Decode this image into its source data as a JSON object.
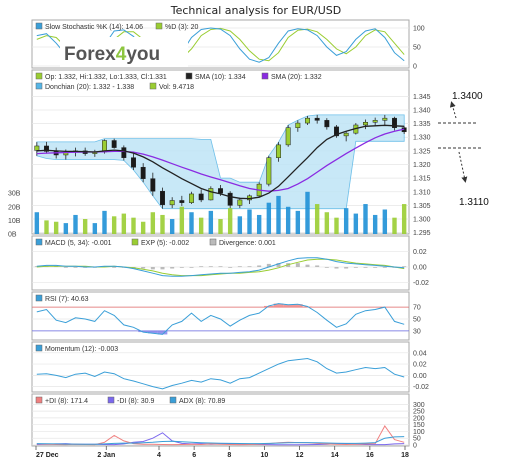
{
  "chart_data": {
    "type": "line",
    "title": "Technical analysis for EUR/USD",
    "x_ticks": [
      "27 Dec",
      "2 Jan",
      "4",
      "6",
      "8",
      "10",
      "12",
      "14",
      "16",
      "18"
    ],
    "stochastic": {
      "legend": [
        "Slow Stochastic %K (14): 14.06",
        "%D (3): 20"
      ],
      "ticks": [
        "100",
        "50",
        "0"
      ],
      "range": [
        0,
        100
      ],
      "k": [
        80,
        85,
        60,
        30,
        10,
        12,
        18,
        55,
        92,
        95,
        78,
        45,
        20,
        8,
        15,
        35,
        75,
        96,
        100,
        97,
        80,
        45,
        18,
        10,
        22,
        60,
        92,
        98,
        95,
        80,
        50,
        28,
        38,
        70,
        92,
        98,
        75,
        35,
        14
      ],
      "d": [
        70,
        80,
        75,
        50,
        25,
        12,
        14,
        30,
        70,
        90,
        90,
        70,
        42,
        20,
        12,
        20,
        45,
        80,
        96,
        99,
        92,
        70,
        40,
        18,
        14,
        35,
        75,
        94,
        97,
        90,
        70,
        45,
        32,
        50,
        80,
        95,
        90,
        60,
        30
      ]
    },
    "price": {
      "legend": [
        "Op: 1.332, Hi:1.332, Lo:1.333, Cl:1.331",
        "SMA (10): 1.334",
        "SMA (20): 1.332",
        "Donchian (20): 1.332 - 1.338",
        "Vol: 9.4718"
      ],
      "ticks": [
        "1.345",
        "1.340",
        "1.335",
        "1.330",
        "1.325",
        "1.320",
        "1.315",
        "1.310",
        "1.305",
        "1.300",
        "1.295"
      ],
      "vol_ticks": [
        "30B",
        "20B",
        "10B",
        "0B"
      ],
      "range": [
        1.2945,
        1.3455
      ],
      "candles": [
        [
          1.3252,
          1.3282,
          1.3232,
          1.3268
        ],
        [
          1.3268,
          1.3283,
          1.324,
          1.3248
        ],
        [
          1.3248,
          1.3262,
          1.3222,
          1.3235
        ],
        [
          1.3235,
          1.3255,
          1.3218,
          1.3245
        ],
        [
          1.3245,
          1.3262,
          1.323,
          1.325
        ],
        [
          1.325,
          1.3262,
          1.3232,
          1.324
        ],
        [
          1.324,
          1.3254,
          1.3228,
          1.3246
        ],
        [
          1.3246,
          1.3292,
          1.324,
          1.3288
        ],
        [
          1.3288,
          1.3295,
          1.3258,
          1.3262
        ],
        [
          1.3262,
          1.327,
          1.3215,
          1.3225
        ],
        [
          1.3225,
          1.324,
          1.318,
          1.319
        ],
        [
          1.319,
          1.3205,
          1.3135,
          1.3148
        ],
        [
          1.3148,
          1.317,
          1.3085,
          1.3102
        ],
        [
          1.3102,
          1.3115,
          1.3038,
          1.3052
        ],
        [
          1.3052,
          1.308,
          1.304,
          1.3068
        ],
        [
          1.3068,
          1.3085,
          1.3048,
          1.306
        ],
        [
          1.306,
          1.31,
          1.3055,
          1.3092
        ],
        [
          1.3092,
          1.3108,
          1.3062,
          1.307
        ],
        [
          1.307,
          1.312,
          1.3068,
          1.3112
        ],
        [
          1.3112,
          1.3125,
          1.3085,
          1.3095
        ],
        [
          1.3095,
          1.3102,
          1.304,
          1.305
        ],
        [
          1.305,
          1.3078,
          1.304,
          1.307
        ],
        [
          1.307,
          1.309,
          1.3055,
          1.3085
        ],
        [
          1.3085,
          1.3135,
          1.308,
          1.3128
        ],
        [
          1.3128,
          1.3232,
          1.312,
          1.3225
        ],
        [
          1.3225,
          1.3282,
          1.321,
          1.3272
        ],
        [
          1.3272,
          1.3345,
          1.3265,
          1.3335
        ],
        [
          1.3335,
          1.3362,
          1.332,
          1.3352
        ],
        [
          1.3352,
          1.3378,
          1.3345,
          1.337
        ],
        [
          1.337,
          1.3382,
          1.335,
          1.3362
        ],
        [
          1.3362,
          1.337,
          1.3328,
          1.3338
        ],
        [
          1.3338,
          1.3345,
          1.3298,
          1.3305
        ],
        [
          1.3305,
          1.3322,
          1.3285,
          1.3315
        ],
        [
          1.3315,
          1.3352,
          1.331,
          1.3345
        ],
        [
          1.3345,
          1.3365,
          1.333,
          1.3355
        ],
        [
          1.3355,
          1.3372,
          1.334,
          1.3362
        ],
        [
          1.3362,
          1.3382,
          1.3345,
          1.337
        ],
        [
          1.337,
          1.3375,
          1.3325,
          1.3335
        ],
        [
          1.3335,
          1.334,
          1.3312,
          1.332
        ]
      ],
      "sma10": [
        1.325,
        1.3252,
        1.325,
        1.3248,
        1.3248,
        1.3247,
        1.3246,
        1.325,
        1.3253,
        1.325,
        1.3242,
        1.3228,
        1.321,
        1.3188,
        1.3168,
        1.3148,
        1.313,
        1.3112,
        1.31,
        1.3092,
        1.3082,
        1.3076,
        1.3075,
        1.308,
        1.3095,
        1.312,
        1.3155,
        1.319,
        1.3225,
        1.3262,
        1.3292,
        1.331,
        1.3322,
        1.3332,
        1.334,
        1.3342,
        1.3344,
        1.3342,
        1.334
      ],
      "sma20": [
        1.324,
        1.3242,
        1.3243,
        1.3244,
        1.3245,
        1.3246,
        1.3246,
        1.3247,
        1.3248,
        1.3248,
        1.3245,
        1.3238,
        1.3228,
        1.3216,
        1.3203,
        1.319,
        1.3178,
        1.3165,
        1.3154,
        1.3144,
        1.3133,
        1.3122,
        1.3112,
        1.3106,
        1.3102,
        1.3105,
        1.3112,
        1.3128,
        1.3148,
        1.3172,
        1.3196,
        1.3218,
        1.324,
        1.326,
        1.328,
        1.3298,
        1.3312,
        1.3322,
        1.333
      ],
      "donchian_upper": [
        1.3283,
        1.3283,
        1.3283,
        1.3283,
        1.3283,
        1.3283,
        1.3283,
        1.3295,
        1.3295,
        1.3295,
        1.3295,
        1.3295,
        1.3295,
        1.3295,
        1.3295,
        1.3295,
        1.3295,
        1.3292,
        1.3292,
        1.315,
        1.315,
        1.3135,
        1.3135,
        1.3135,
        1.3232,
        1.3282,
        1.3345,
        1.3362,
        1.3378,
        1.3382,
        1.3382,
        1.3382,
        1.3382,
        1.3382,
        1.3382,
        1.3382,
        1.3382,
        1.3382,
        1.3382
      ],
      "donchian_lower": [
        1.3232,
        1.3222,
        1.3218,
        1.3218,
        1.3218,
        1.3218,
        1.3218,
        1.3218,
        1.3218,
        1.3215,
        1.318,
        1.3135,
        1.3085,
        1.3038,
        1.3038,
        1.3038,
        1.3038,
        1.3038,
        1.3038,
        1.3038,
        1.3038,
        1.3038,
        1.3038,
        1.3038,
        1.3038,
        1.3038,
        1.3038,
        1.3038,
        1.3038,
        1.3038,
        1.3038,
        1.3038,
        1.3038,
        1.3285,
        1.3285,
        1.3285,
        1.3285,
        1.3285,
        1.3285
      ],
      "volume": [
        16,
        10,
        9,
        8,
        14,
        11,
        8,
        17,
        13,
        15,
        12,
        9,
        16,
        14,
        11,
        20,
        16,
        12,
        17,
        11,
        19,
        13,
        18,
        14,
        23,
        28,
        20,
        17,
        31,
        22,
        16,
        12,
        19,
        15,
        22,
        14,
        18,
        12,
        22
      ]
    },
    "macd": {
      "legend": [
        "MACD (5, 34): -0.001",
        "EXP (5): -0.002",
        "Divergence: 0.001"
      ],
      "ticks": [
        "0.02",
        "0.00",
        "-0.02"
      ],
      "range": [
        -0.027,
        0.027
      ],
      "macd": [
        0.001,
        0.002,
        0.002,
        0.001,
        0.001,
        0.0,
        0.0,
        0.001,
        0.001,
        0.0,
        -0.002,
        -0.005,
        -0.008,
        -0.011,
        -0.012,
        -0.012,
        -0.011,
        -0.01,
        -0.009,
        -0.008,
        -0.008,
        -0.007,
        -0.006,
        -0.004,
        0.0,
        0.004,
        0.008,
        0.011,
        0.012,
        0.012,
        0.01,
        0.007,
        0.005,
        0.004,
        0.003,
        0.002,
        0.001,
        0.0,
        -0.001
      ],
      "signal": [
        0.0,
        0.001,
        0.001,
        0.001,
        0.001,
        0.001,
        0.0,
        0.0,
        0.001,
        0.0,
        -0.001,
        -0.003,
        -0.005,
        -0.008,
        -0.01,
        -0.011,
        -0.011,
        -0.011,
        -0.01,
        -0.009,
        -0.008,
        -0.008,
        -0.007,
        -0.006,
        -0.004,
        -0.001,
        0.003,
        0.006,
        0.009,
        0.01,
        0.01,
        0.009,
        0.007,
        0.005,
        0.004,
        0.003,
        0.002,
        0.0,
        -0.002
      ],
      "divergence": [
        0.001,
        0.001,
        0.001,
        0.0,
        0.0,
        -0.001,
        0.0,
        0.001,
        0.0,
        0.0,
        -0.001,
        -0.002,
        -0.003,
        -0.003,
        -0.002,
        -0.001,
        0.0,
        0.001,
        0.001,
        0.001,
        0.0,
        0.001,
        0.001,
        0.002,
        0.004,
        0.005,
        0.005,
        0.005,
        0.003,
        0.002,
        0.0,
        -0.002,
        -0.002,
        -0.001,
        -0.001,
        -0.001,
        -0.001,
        0.0,
        0.001
      ]
    },
    "rsi": {
      "legend": [
        "RSI (7): 40.63"
      ],
      "ticks": [
        "70",
        "50",
        "30"
      ],
      "range": [
        18,
        82
      ],
      "values": [
        62,
        66,
        48,
        44,
        52,
        50,
        46,
        64,
        56,
        40,
        36,
        28,
        26,
        24,
        40,
        46,
        60,
        46,
        56,
        50,
        38,
        48,
        56,
        60,
        72,
        76,
        74,
        75,
        71,
        61,
        48,
        36,
        42,
        58,
        64,
        66,
        70,
        46,
        41
      ]
    },
    "momentum": {
      "legend": [
        "Momentum (12): -0.003"
      ],
      "ticks": [
        "0.04",
        "0.02",
        "0.00",
        "-0.02"
      ],
      "range": [
        -0.026,
        0.045
      ],
      "values": [
        0.002,
        0.003,
        0.0,
        -0.004,
        0.002,
        0.004,
        -0.002,
        0.006,
        0.003,
        -0.006,
        -0.01,
        -0.015,
        -0.02,
        -0.024,
        -0.018,
        -0.014,
        -0.009,
        -0.012,
        -0.006,
        -0.008,
        -0.014,
        -0.006,
        -0.004,
        0.004,
        0.012,
        0.02,
        0.026,
        0.028,
        0.03,
        0.024,
        0.012,
        0.004,
        0.006,
        0.01,
        0.014,
        0.012,
        0.014,
        0.002,
        -0.003
      ]
    },
    "adx": {
      "legend": [
        "+DI (8): 171.4",
        "-DI (8): 30.9",
        "ADX (8): 70.89"
      ],
      "ticks": [
        "300",
        "250",
        "200",
        "150",
        "100",
        "50",
        "0"
      ],
      "range": [
        0,
        310
      ],
      "plus_di": [
        8,
        6,
        4,
        3,
        5,
        4,
        3,
        20,
        70,
        30,
        10,
        6,
        5,
        4,
        3,
        4,
        6,
        4,
        8,
        5,
        4,
        3,
        4,
        6,
        10,
        16,
        20,
        18,
        16,
        12,
        8,
        5,
        4,
        6,
        8,
        10,
        140,
        40,
        20
      ],
      "minus_di": [
        4,
        6,
        8,
        10,
        6,
        5,
        6,
        4,
        3,
        8,
        20,
        26,
        50,
        90,
        30,
        12,
        8,
        10,
        6,
        8,
        10,
        8,
        6,
        4,
        3,
        2,
        2,
        2,
        3,
        4,
        6,
        10,
        8,
        6,
        4,
        3,
        3,
        8,
        10
      ],
      "adx": [
        10,
        9,
        8,
        7,
        7,
        6,
        6,
        8,
        12,
        14,
        14,
        16,
        20,
        26,
        28,
        24,
        20,
        17,
        15,
        13,
        12,
        11,
        10,
        10,
        12,
        14,
        16,
        18,
        18,
        17,
        15,
        13,
        12,
        12,
        14,
        18,
        50,
        60,
        62
      ]
    },
    "annotations": [
      "1.3400",
      "1.3110"
    ]
  },
  "logo": {
    "text_a": "Forex",
    "text_b": "4",
    "text_c": "you"
  }
}
